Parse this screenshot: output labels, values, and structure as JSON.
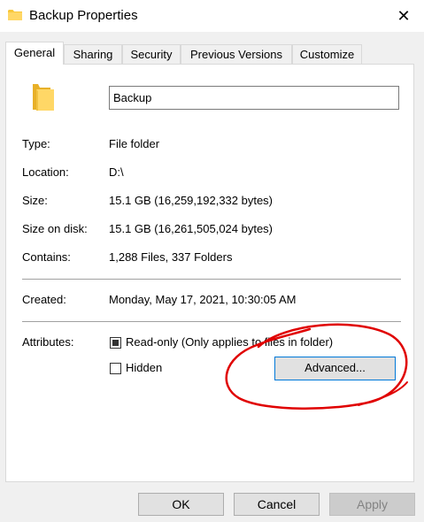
{
  "window": {
    "title": "Backup Properties",
    "close_glyph": "✕"
  },
  "tabs": [
    {
      "label": "General",
      "active": true
    },
    {
      "label": "Sharing",
      "active": false
    },
    {
      "label": "Security",
      "active": false
    },
    {
      "label": "Previous Versions",
      "active": false
    },
    {
      "label": "Customize",
      "active": false
    }
  ],
  "general": {
    "folder_name": "Backup",
    "rows": [
      {
        "label": "Type:",
        "value": "File folder"
      },
      {
        "label": "Location:",
        "value": "D:\\"
      },
      {
        "label": "Size:",
        "value": "15.1 GB (16,259,192,332 bytes)"
      },
      {
        "label": "Size on disk:",
        "value": "15.1 GB (16,261,505,024 bytes)"
      },
      {
        "label": "Contains:",
        "value": "1,288 Files, 337 Folders"
      }
    ],
    "created": {
      "label": "Created:",
      "value": "Monday, May 17, 2021, 10:30:05 AM"
    },
    "attributes": {
      "label": "Attributes:",
      "read_only": {
        "label": "Read-only (Only applies to files in folder)",
        "state": "indeterminate"
      },
      "hidden": {
        "label": "Hidden",
        "state": "unchecked"
      },
      "advanced_button": "Advanced..."
    }
  },
  "buttons": {
    "ok": "OK",
    "cancel": "Cancel",
    "apply": "Apply"
  },
  "colors": {
    "folder": "#f8c83c",
    "focus": "#0078d7",
    "annotation": "#e00000"
  }
}
